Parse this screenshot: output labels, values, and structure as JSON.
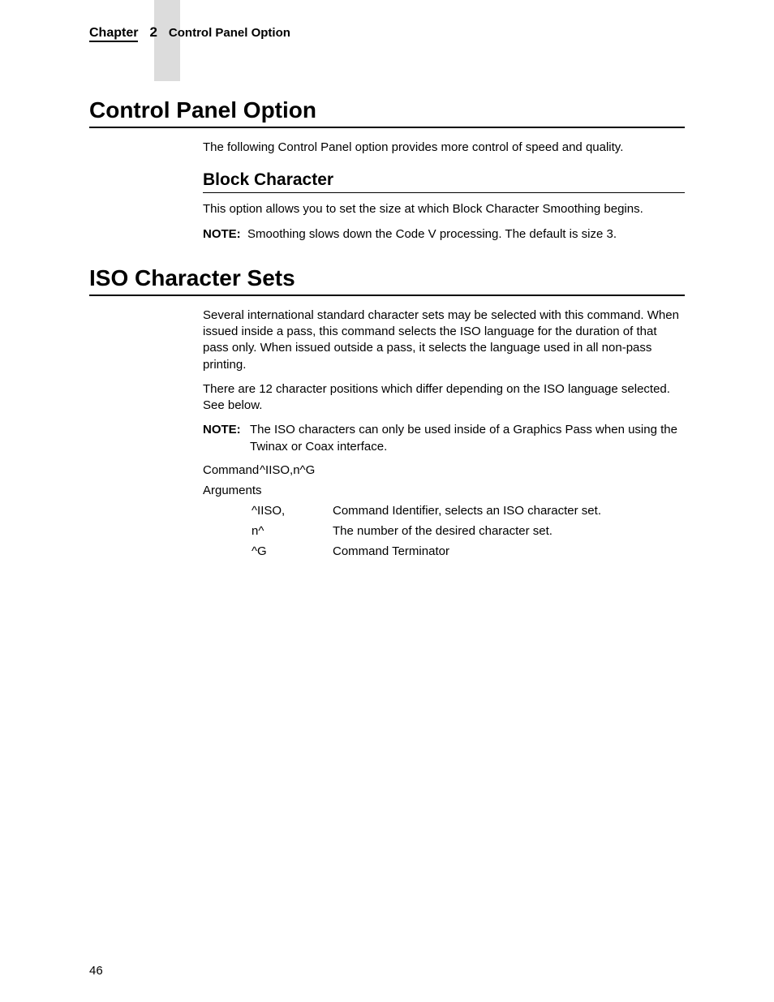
{
  "header": {
    "chapter_label": "Chapter",
    "chapter_number": "2",
    "title": "Control Panel Option"
  },
  "s1": {
    "h": "Control Panel Option",
    "p1": "The following Control Panel option provides more control of speed and quality.",
    "sub_h": "Block Character",
    "p2": "This option allows you to set the size at which Block Character Smoothing begins.",
    "note_label": "NOTE:",
    "note_text": "Smoothing slows down the Code V processing. The default is size 3."
  },
  "s2": {
    "h": "ISO Character Sets",
    "p1": "Several international standard character sets may be selected with this command. When issued inside a pass, this command selects the ISO language for the duration of that pass only. When issued outside a pass, it selects the language used in all non-pass printing.",
    "p2": "There are 12 character positions which differ depending on the ISO language selected. See below.",
    "note_label": "NOTE:",
    "note_text": "The ISO characters can only be used inside of a Graphics Pass when using the Twinax or Coax interface.",
    "cmd_label": "Command",
    "cmd_value": "^IISO,n^G",
    "args_label": "Arguments",
    "args": [
      {
        "a": "^IISO,",
        "d": "Command Identifier, selects an ISO character set."
      },
      {
        "a": "n^",
        "d": "The number of the desired character set."
      },
      {
        "a": "^G",
        "d": "Command Terminator"
      }
    ]
  },
  "page_number": "46"
}
